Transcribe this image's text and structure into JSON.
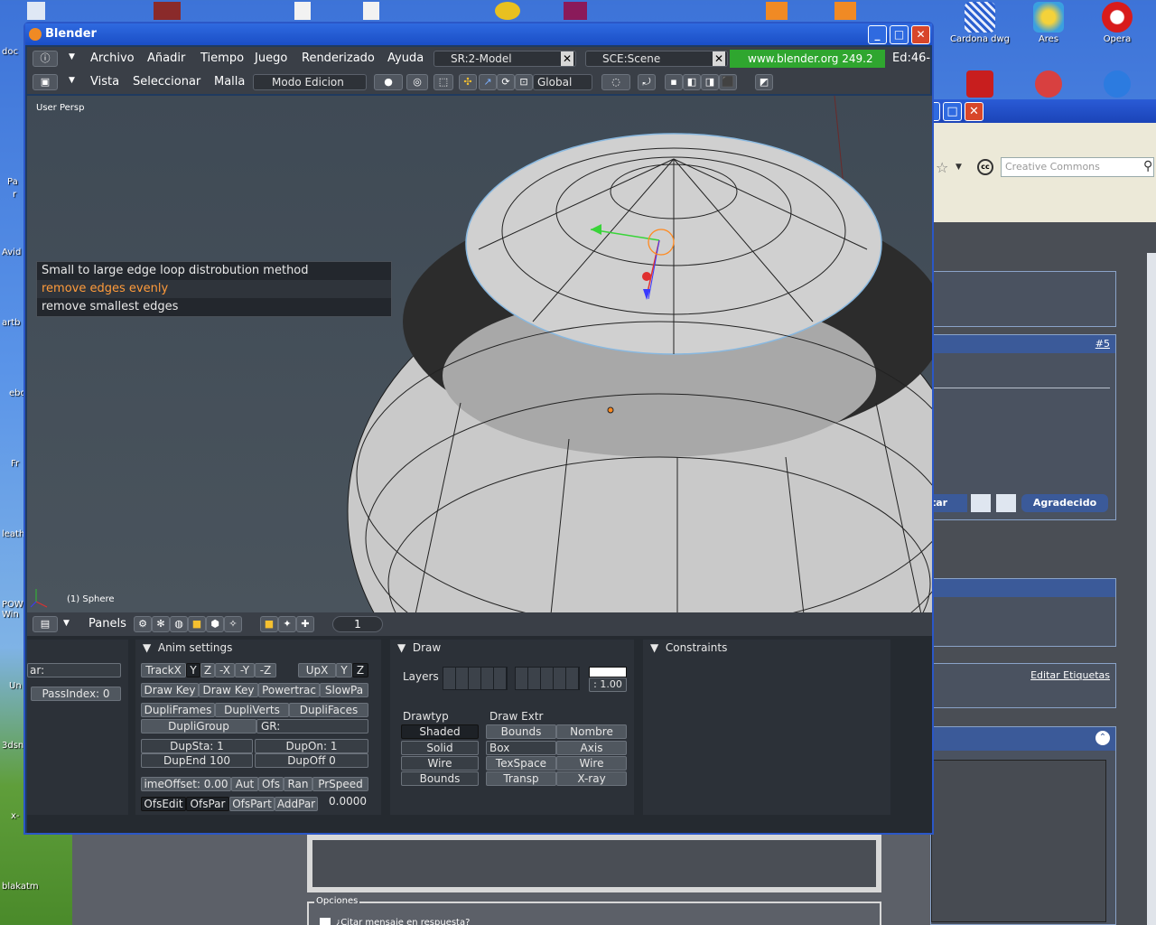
{
  "desktop": {
    "icons": [
      {
        "label": "Cardona dwg",
        "color": "#3b6fd0"
      },
      {
        "label": "Ares",
        "color": "#3aa0e0"
      },
      {
        "label": "Opera",
        "color": "#d81b1b"
      }
    ],
    "left_labels": [
      "doc",
      "Pa",
      "r",
      "Avid",
      "artb",
      "ebo",
      "Fr",
      "leath",
      "POW Win",
      "Un",
      "3dsn",
      "x-",
      "blakatm"
    ]
  },
  "browser": {
    "search_placeholder": "Creative Commons",
    "post_number": "#5",
    "button_partial": "tar",
    "button_thanks": "Agradecido",
    "edit_tags_link": "Editar Etiquetas",
    "options_label": "Opciones",
    "quote_checkbox_label": "¿Citar mensaje en respuesta?"
  },
  "blender": {
    "title": "Blender",
    "menus": [
      "Archivo",
      "Añadir",
      "Tiempo",
      "Juego",
      "Renderizado",
      "Ayuda"
    ],
    "screen_field": "SR:2-Model",
    "scene_field": "SCE:Scene",
    "website": "www.blender.org 249.2",
    "status": "Ed:46-",
    "view_header": {
      "menus": [
        "Vista",
        "Seleccionar",
        "Malla"
      ],
      "mode": "Modo Edicion",
      "orientation": "Global"
    },
    "viewport": {
      "perspective_label": "User Persp",
      "object_label": "(1) Sphere",
      "popup_items": [
        {
          "label": "Small to large edge loop distrobution method",
          "selected": false
        },
        {
          "label": "remove edges evenly",
          "selected": true
        },
        {
          "label": "remove smallest edges",
          "selected": false
        }
      ]
    },
    "buttons_window": {
      "header_label": "Panels",
      "frame_number": "1",
      "left_panel": {
        "field_partial": "ar:",
        "pass_index": "PassIndex: 0"
      },
      "anim_settings": {
        "title": "Anim settings",
        "track_buttons": [
          "TrackX",
          "Y",
          "Z",
          "-X",
          "-Y",
          "-Z"
        ],
        "up_buttons": [
          "UpX",
          "Y",
          "Z"
        ],
        "row2": [
          "Draw Key",
          "Draw Key",
          "Powertrac",
          "SlowPa"
        ],
        "row3": [
          "DupliFrames",
          "DupliVerts",
          "DupliFaces"
        ],
        "dupli_group": "DupliGroup",
        "group_field": "GR:",
        "dup_sta": "DupSta: 1",
        "dup_on": "DupOn: 1",
        "dup_end": "DupEnd 100",
        "dup_off": "DupOff 0",
        "time_offset": "imeOffset: 0.00",
        "row_buttons": [
          "Aut",
          "Ofs",
          "Ran",
          "PrSpeed"
        ],
        "ofs_buttons": [
          "OfsEdit",
          "OfsPar",
          "OfsPart",
          "AddPar"
        ],
        "value": "0.0000"
      },
      "draw": {
        "title": "Draw",
        "layers_label": "Layers",
        "color_value": ": 1.00",
        "drawtype_label": "Drawtyp",
        "drawtypes": [
          "Shaded",
          "Solid",
          "Wire",
          "Bounds"
        ],
        "draw_extra_label": "Draw Extr",
        "extras_left": [
          "Bounds",
          "Box",
          "TexSpace",
          "Transp"
        ],
        "extras_right": [
          "Nombre",
          "Axis",
          "Wire",
          "X-ray"
        ]
      },
      "constraints": {
        "title": "Constraints"
      }
    }
  }
}
